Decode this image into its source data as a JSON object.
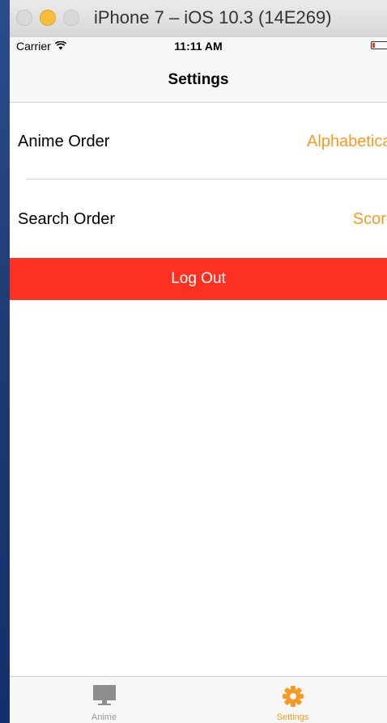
{
  "window": {
    "title": "iPhone 7 – iOS 10.3 (14E269)"
  },
  "status_bar": {
    "carrier": "Carrier",
    "time": "11:11 AM"
  },
  "nav": {
    "title": "Settings"
  },
  "settings": {
    "rows": [
      {
        "label": "Anime Order",
        "value": "Alphabetical"
      },
      {
        "label": "Search Order",
        "value": "Score"
      }
    ],
    "logout_label": "Log Out"
  },
  "tab_bar": {
    "items": [
      {
        "label": "Anime",
        "icon": "monitor-icon",
        "selected": false
      },
      {
        "label": "Settings",
        "icon": "gear-icon",
        "selected": true
      }
    ]
  },
  "colors": {
    "accent": "#f59a23",
    "destructive": "#fc3122",
    "traffic_minimize": "#f6bd3c"
  }
}
